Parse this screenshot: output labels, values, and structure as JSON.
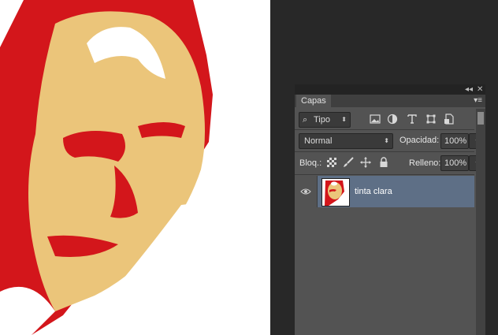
{
  "colors": {
    "red": "#d3161b",
    "tan": "#ebc57a",
    "workspace": "#282828",
    "panel": "#535353",
    "selected_layer": "#5e6f86"
  },
  "panel": {
    "tab_label": "Capas",
    "filter": {
      "value": "Tipo",
      "icon": "search-icon"
    },
    "filter_icons": [
      "image-filter-icon",
      "adjustment-filter-icon",
      "type-filter-icon",
      "shape-filter-icon",
      "smart-object-filter-icon"
    ],
    "blend_mode": "Normal",
    "opacity_label": "Opacidad:",
    "opacity_value": "100%",
    "lock_label": "Bloq.:",
    "lock_icons": [
      "lock-pixels-icon",
      "lock-brush-icon",
      "lock-position-icon",
      "lock-all-icon"
    ],
    "fill_label": "Relleno:",
    "fill_value": "100%",
    "layers": [
      {
        "name": "tinta clara",
        "visible": true,
        "selected": true
      }
    ]
  }
}
